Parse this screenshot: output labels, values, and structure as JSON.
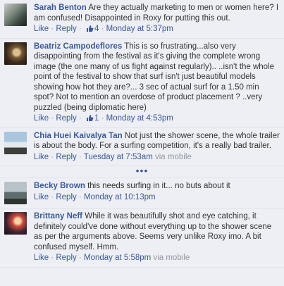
{
  "comments": [
    {
      "author": "Sarah Benton",
      "text": "Are they actually marketing to men or women here? I am confused! Disappointed in Roxy for putting this out.",
      "like_label": "Like",
      "reply_label": "Reply",
      "like_count": "4",
      "timestamp": "Monday at 5:37pm",
      "via": ""
    },
    {
      "author": "Beatriz Campodeflores",
      "text": "This is so frustrating...also very disappointing from the festival as it's giving the complete wrong image (the one many of us fight against regularly).. ..isn't the whole point of the festival to show that surf isn't just beautiful models showing how hot they are?... 3 sec of actual surf for a 1.50 min spot? Not to mention an overdose of product placement ? ..very puzzled (being diplomatic here)",
      "like_label": "Like",
      "reply_label": "Reply",
      "like_count": "1",
      "timestamp": "Monday at 4:53pm",
      "via": ""
    },
    {
      "author": "Chia Huei Kaivalya Tan",
      "text": "Not just the shower scene, the whole trailer is about the body. For a surfing competition, it's a really bad trailer.",
      "like_label": "Like",
      "reply_label": "Reply",
      "like_count": "",
      "timestamp": "Tuesday at 7:53am",
      "via": "via mobile"
    },
    {
      "author": "Becky Brown",
      "text": "this needs surfing in it... no buts about it",
      "like_label": "Like",
      "reply_label": "Reply",
      "like_count": "",
      "timestamp": "Monday at 10:13pm",
      "via": ""
    },
    {
      "author": "Brittany Neff",
      "text": "While it was beautifully shot and eye catching, it definitely could've done without everything up to the shower scene as per the arguments above. Seems very unlike Roxy imo. A bit confused myself. Hmm.",
      "like_label": "Like",
      "reply_label": "Reply",
      "like_count": "",
      "timestamp": "Monday at 5:58pm",
      "via": "via mobile"
    }
  ],
  "separator": " · ",
  "more_indicator": "•••",
  "colors": {
    "link": "#3b5998",
    "meta": "#9197a3",
    "background": "#edeff4"
  }
}
